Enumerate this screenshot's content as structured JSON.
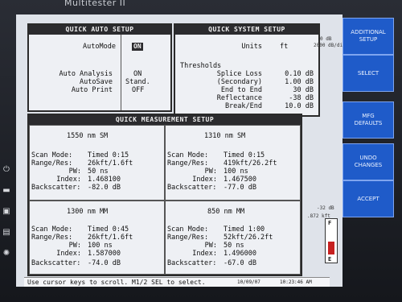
{
  "device": {
    "brand": "Multitester II"
  },
  "quick_auto": {
    "title": "QUICK AUTO SETUP",
    "auto_mode_label": "AutoMode",
    "auto_mode_value": "ON",
    "auto_analysis_label": "Auto Analysis",
    "auto_analysis_value": "ON",
    "autosave_label": "AutoSave",
    "autosave_value": "Stand.",
    "auto_print_label": "Auto Print",
    "auto_print_value": "OFF"
  },
  "quick_system": {
    "title": "QUICK SYSTEM SETUP",
    "units_label": "Units",
    "units_value": "ft",
    "thresholds_label": "Thresholds",
    "splice_loss_label": "Splice Loss",
    "splice_loss_value": "0.10 dB",
    "secondary_label": "(Secondary)",
    "secondary_value": "1.00 dB",
    "end_to_end_label": "End to End",
    "end_to_end_value": "30 dB",
    "reflectance_label": "Reflectance",
    "reflectance_value": "-38 dB",
    "break_end_label": "Break/End",
    "break_end_value": "10.0 dB"
  },
  "quick_measurement": {
    "title": "QUICK MEASUREMENT SETUP",
    "cells": [
      {
        "name": "1550 nm SM",
        "scan_label": "Scan Mode:",
        "scan": "Timed 0:15",
        "range_label": "Range/Res:",
        "range": "26kft/1.6ft",
        "pw_label": "PW:",
        "pw": "50 ns",
        "index_label": "Index:",
        "index": "1.468100",
        "bs_label": "Backscatter:",
        "bs": "-82.0 dB"
      },
      {
        "name": "1310 nm SM",
        "scan_label": "Scan Mode:",
        "scan": "Timed 0:15",
        "range_label": "Range/Res:",
        "range": "419kft/26.2ft",
        "pw_label": "PW:",
        "pw": "100 ns",
        "index_label": "Index:",
        "index": "1.467500",
        "bs_label": "Backscatter:",
        "bs": "-77.0 dB"
      },
      {
        "name": "1300 nm MM",
        "scan_label": "Scan Mode:",
        "scan": "Timed 0:45",
        "range_label": "Range/Res:",
        "range": "26kft/1.6ft",
        "pw_label": "PW:",
        "pw": "100 ns",
        "index_label": "Index:",
        "index": "1.587000",
        "bs_label": "Backscatter:",
        "bs": "-74.0 dB"
      },
      {
        "name": "850 nm MM",
        "scan_label": "Scan Mode:",
        "scan": "Timed 1:00",
        "range_label": "Range/Res:",
        "range": "52kft/26.2ft",
        "pw_label": "PW:",
        "pw": "50 ns",
        "index_label": "Index:",
        "index": "1.496000",
        "bs_label": "Backscatter:",
        "bs": "-67.0 dB"
      }
    ]
  },
  "right_strip": {
    "top_db": "0 dB",
    "scale": "2000 dB/div",
    "neg": "-32 dB",
    "dist": ".872 kft"
  },
  "battery": {
    "top": "F",
    "bottom": "E",
    "level": 0.45
  },
  "status": {
    "hint": "Use cursor keys to scroll. M1/2 SEL to select.",
    "date": "10/09/07",
    "time": "10:23:46 AM"
  },
  "softkeys": [
    {
      "label": "ADDITIONAL\nSETUP"
    },
    {
      "label": "SELECT"
    },
    {
      "label": "MFG\nDEFAULTS"
    },
    {
      "label": "UNDO\nCHANGES"
    },
    {
      "label": "ACCEPT"
    }
  ],
  "colors": {
    "softkey": "#1f5bc9",
    "title_bar": "#2b2b2e",
    "battery": "#c62020"
  }
}
